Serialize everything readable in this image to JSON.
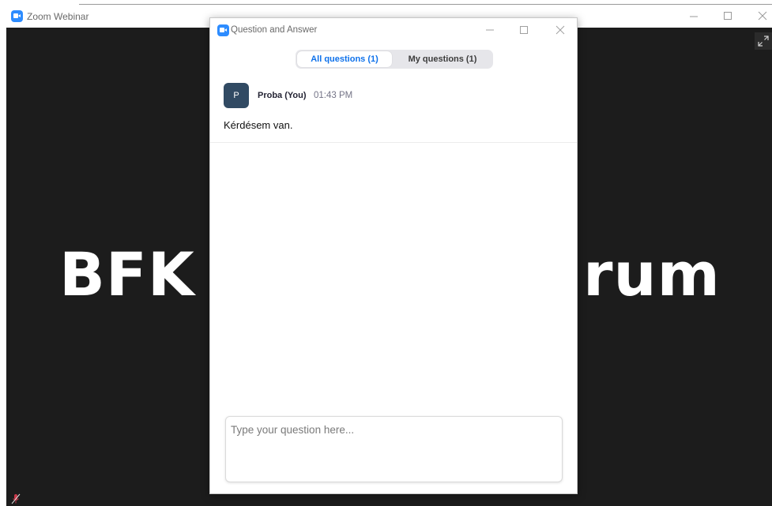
{
  "main_window": {
    "title": "Zoom Webinar",
    "icon": "zoom-app-icon",
    "controls": [
      "minimize-icon",
      "maximize-icon",
      "close-icon"
    ]
  },
  "presentation": {
    "slide_text_left": "BFK",
    "slide_text_right": "rum"
  },
  "qa_window": {
    "title": "Question and Answer",
    "icon": "zoom-app-icon",
    "controls": [
      "minimize-icon",
      "maximize-icon",
      "close-icon"
    ],
    "tabs": [
      {
        "label": "All questions (1)",
        "selected": true
      },
      {
        "label": "My questions (1)",
        "selected": false
      }
    ],
    "questions": [
      {
        "avatar_initial": "P",
        "author": "Proba (You)",
        "time": "01:43 PM",
        "text": "Kérdésem van."
      }
    ],
    "input": {
      "value": "",
      "placeholder": "Type your question here..."
    }
  },
  "colors": {
    "accent": "#0e71eb",
    "zoom_blue": "#2d8cff",
    "stage_background": "#1c1c1c",
    "avatar": "#314a63"
  }
}
